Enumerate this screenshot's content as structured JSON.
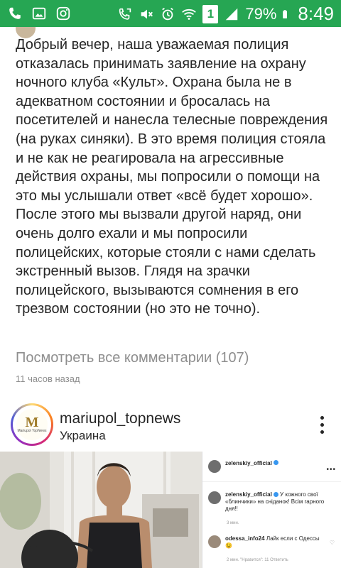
{
  "status_bar": {
    "battery_percent": "79%",
    "time": "8:49",
    "sim_label": "1"
  },
  "post_caption": {
    "text": "Добрый вечер, наша уважаемая полиция отказалась принимать заявление на охрану ночного клуба «Культ». Охрана была не в адекватном состоянии и бросалась на посетителей и нанесла телесные повреждения (на руках синяки). В это время полиция стояла и не как не реагировала на агрессивные действия охраны, мы попросили о помощи на это мы услышали ответ «всё будет хорошо». После этого мы вызвали другой наряд, они очень долго ехали и мы попросили полицейских, которые стояли с нами сделать экстренный вызов. Глядя на зрачки полицейского, вызываются сомнения в его трезвом состоянии (но это не точно).",
    "view_comments": "Посмотреть все комментарии (107)",
    "time_ago": "11 часов назад"
  },
  "next_post": {
    "username": "mariupol_topnews",
    "location": "Украина",
    "avatar_letter": "M",
    "avatar_sub": "Mariupol TopNews"
  },
  "embedded_screenshot": {
    "author": "zelenskiy_official",
    "comment_author": "zelenskiy_official",
    "comment_text": "У кожного свої «блинчики» на сніданок! Всім гарного дня!!",
    "comment_time": "3 мин.",
    "reply_author": "odessa_info24",
    "reply_text": "Лайк если с Одессы😉",
    "reply_meta": "2 мин.  \"Нравится\": 11  Ответить"
  },
  "colors": {
    "status_bar": "#26a653",
    "secondary_text": "#8e8e8e"
  }
}
